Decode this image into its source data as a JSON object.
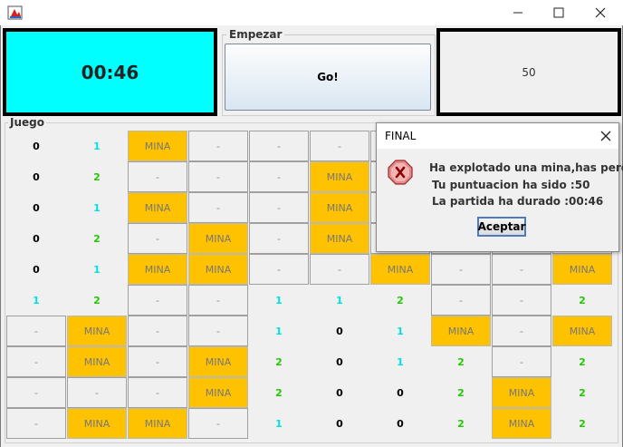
{
  "window": {
    "minimize_icon": "minimize-icon",
    "maximize_icon": "maximize-icon",
    "close_icon": "close-icon"
  },
  "timer": {
    "value": "00:46",
    "color": "#00ffff"
  },
  "start": {
    "group_label": "Empezar",
    "button_label": "Go!"
  },
  "score": {
    "value": "50"
  },
  "game": {
    "group_label": "Juego",
    "mine_label": "MINA",
    "hidden_label": "-",
    "mine_color": "#ffc200",
    "rows": [
      [
        "0",
        "1",
        "MINA",
        "-",
        "-",
        "-",
        "-",
        "-",
        "-",
        "-"
      ],
      [
        "0",
        "2",
        "-",
        "-",
        "-",
        "MINA",
        "-",
        "-",
        "-",
        "-"
      ],
      [
        "0",
        "1",
        "MINA",
        "-",
        "-",
        "MINA",
        "-",
        "-",
        "-",
        "-"
      ],
      [
        "0",
        "2",
        "-",
        "MINA",
        "-",
        "MINA",
        "-",
        "-",
        "-",
        "-"
      ],
      [
        "0",
        "1",
        "MINA",
        "MINA",
        "-",
        "-",
        "MINA",
        "-",
        "-",
        "MINA"
      ],
      [
        "1",
        "2",
        "-",
        "-",
        "1",
        "1",
        "2",
        "-",
        "-",
        "2"
      ],
      [
        "-",
        "MINA",
        "-",
        "-",
        "1",
        "0",
        "1",
        "MINA",
        "-",
        "MINA"
      ],
      [
        "-",
        "MINA",
        "-",
        "MINA",
        "2",
        "0",
        "1",
        "2",
        "-",
        "2"
      ],
      [
        "-",
        "-",
        "-",
        "MINA",
        "2",
        "0",
        "0",
        "2",
        "MINA",
        "2"
      ],
      [
        "-",
        "MINA",
        "MINA",
        "-",
        "1",
        "0",
        "0",
        "2",
        "MINA",
        "2"
      ]
    ]
  },
  "dialog": {
    "title": "FINAL",
    "icon": "error-icon",
    "line1": "Ha explotado una mina,has perdido",
    "line2": "Tu puntuacion ha sido :50",
    "line3": "La partida ha durado :00:46",
    "ok_label": "Aceptar"
  }
}
